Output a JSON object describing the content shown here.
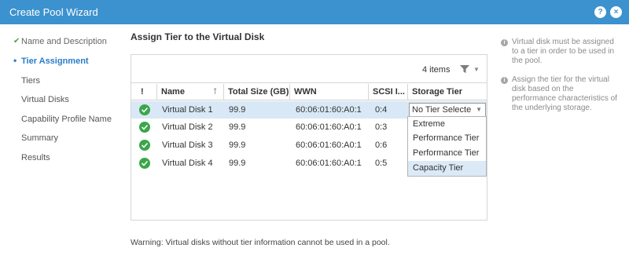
{
  "window": {
    "title": "Create Pool Wizard",
    "help_icon": "?",
    "close_icon": "×"
  },
  "sidebar": {
    "items": [
      {
        "label": "Name and Description",
        "state": "done"
      },
      {
        "label": "Tier Assignment",
        "state": "active"
      },
      {
        "label": "Tiers",
        "state": "pending"
      },
      {
        "label": "Virtual Disks",
        "state": "pending"
      },
      {
        "label": "Capability Profile Name",
        "state": "pending"
      },
      {
        "label": "Summary",
        "state": "pending"
      },
      {
        "label": "Results",
        "state": "pending"
      }
    ]
  },
  "main": {
    "title": "Assign Tier to the Virtual Disk",
    "items_count": "4 items",
    "columns": [
      "!",
      "Name",
      "Total Size (GB)",
      "WWN",
      "SCSI I...",
      "Storage Tier"
    ],
    "rows": [
      {
        "name": "Virtual Disk 1",
        "size": "99.9",
        "wwn": "60:06:01:60:A0:1",
        "scsi": "0:4",
        "tier": "No Tier Selecte",
        "selected": true
      },
      {
        "name": "Virtual Disk 2",
        "size": "99.9",
        "wwn": "60:06:01:60:A0:1",
        "scsi": "0:3"
      },
      {
        "name": "Virtual Disk 3",
        "size": "99.9",
        "wwn": "60:06:01:60:A0:1",
        "scsi": "0:6"
      },
      {
        "name": "Virtual Disk 4",
        "size": "99.9",
        "wwn": "60:06:01:60:A0:1",
        "scsi": "0:5"
      }
    ],
    "dropdown_options": [
      "Extreme",
      "Performance Tier",
      "Performance Tier",
      "Capacity Tier"
    ],
    "highlighted_option": "Capacity Tier",
    "warning": "Warning: Virtual disks without tier information cannot be used in a pool."
  },
  "help": {
    "items": [
      "Virtual disk must be assigned to a tier in order to be used in the pool.",
      "Assign the tier for the virtual disk based on the performance characteristics of the underlying storage."
    ]
  },
  "colors": {
    "titlebar": "#3c92ce",
    "accent": "#2a7cc7",
    "ok": "#3aa64a",
    "selected_row": "#d9e8f6"
  },
  "icons": {
    "status": "check-circle-icon",
    "filter": "filter-icon",
    "info": "info-icon"
  }
}
